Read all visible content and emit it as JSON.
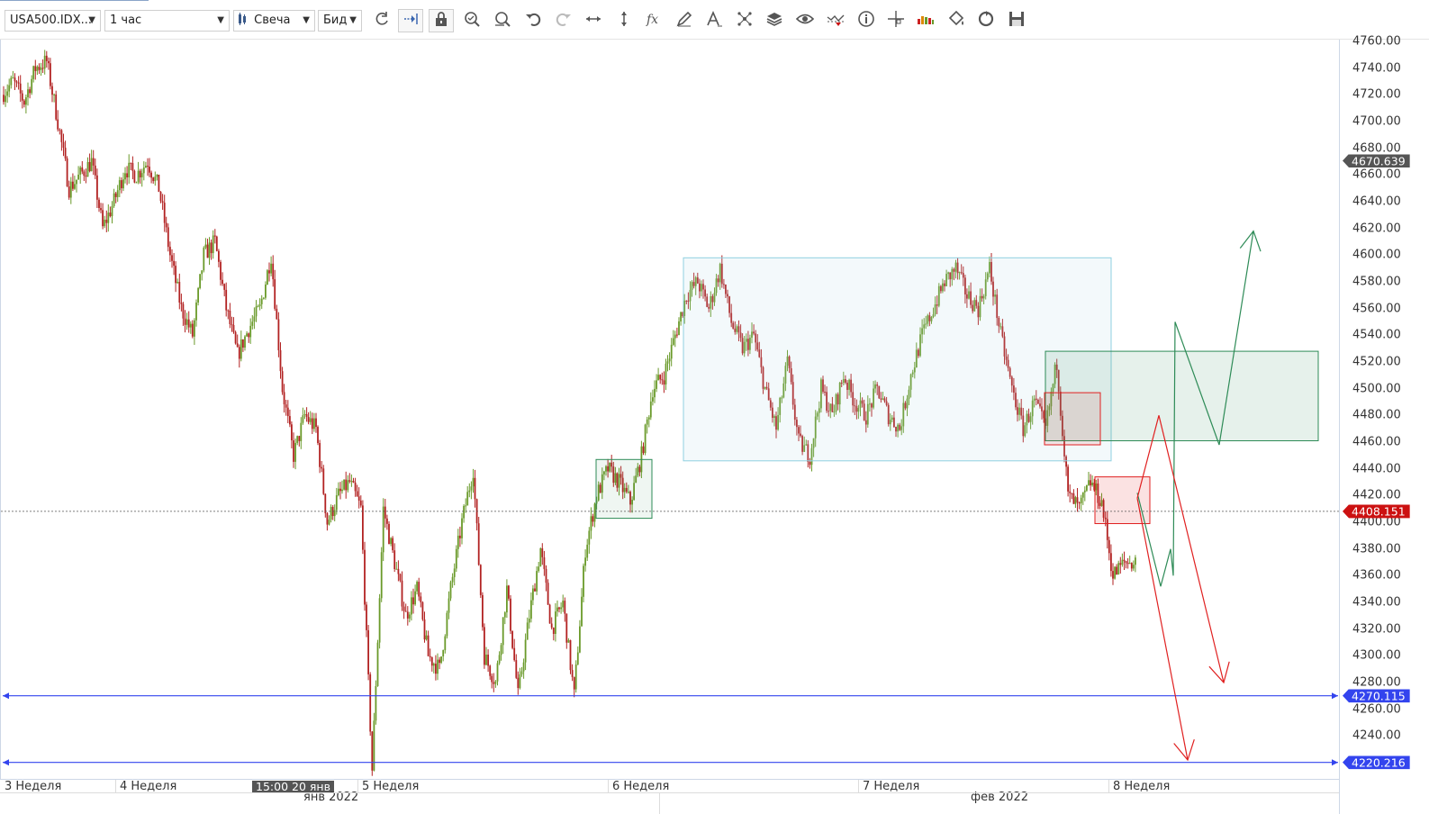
{
  "toolbar": {
    "symbol": "USA500.IDX...",
    "timeframe": "1 час",
    "chart_type": "Свеча",
    "price_side": "Бид",
    "icons": [
      "refresh-icon",
      "auto-scroll-icon",
      "lock-icon",
      "zoom-in-icon",
      "zoom-out-icon",
      "undo-icon",
      "redo-icon",
      "horizontal-stretch-icon",
      "vertical-stretch-icon",
      "indicator-fx-icon",
      "pencil-icon",
      "text-tool-icon",
      "network-icon",
      "layers-icon",
      "eye-icon",
      "signals-icon",
      "info-icon",
      "crosshair-icon",
      "volume-icon",
      "paint-bucket-icon",
      "sync-icon",
      "save-icon"
    ]
  },
  "price_axis": {
    "ticks": [
      "4760.00",
      "4740.00",
      "4720.00",
      "4700.00",
      "4680.00",
      "4660.00",
      "4640.00",
      "4620.00",
      "4600.00",
      "4580.00",
      "4560.00",
      "4540.00",
      "4520.00",
      "4500.00",
      "4480.00",
      "4460.00",
      "4440.00",
      "4420.00",
      "4400.00",
      "4380.00",
      "4360.00",
      "4340.00",
      "4320.00",
      "4300.00",
      "4280.00",
      "4260.00",
      "4240.00",
      "4220.00"
    ],
    "tags": [
      {
        "label": "4670.639",
        "price": 4670.639,
        "color": "#555555"
      },
      {
        "label": "4408.151",
        "price": 4408.151,
        "color": "#cc1111"
      },
      {
        "label": "4270.115",
        "price": 4270.115,
        "color": "#3344ee"
      },
      {
        "label": "4220.216",
        "price": 4220.216,
        "color": "#3344ee"
      }
    ]
  },
  "time_axis": {
    "weeks": [
      "3 Неделя",
      "4 Неделя",
      "5 Неделя",
      "6 Неделя",
      "7 Неделя",
      "8 Неделя"
    ],
    "months": [
      "янв 2022",
      "фев 2022"
    ],
    "cursor_label": "15:00 20 янв"
  },
  "chart_data": {
    "type": "candlestick",
    "symbol": "USA500.IDX",
    "timeframe": "1 час",
    "ylim": [
      4205,
      4765
    ],
    "current_price": 4408.151,
    "horizontal_lines": [
      4270.115,
      4220.216
    ],
    "colors": {
      "up": "#6a9a2a",
      "down": "#b22222",
      "hline": "#3344ee",
      "current": "#555555"
    },
    "path": [
      4720,
      4730,
      4715,
      4740,
      4745,
      4700,
      4650,
      4660,
      4670,
      4620,
      4640,
      4665,
      4660,
      4670,
      4650,
      4600,
      4560,
      4540,
      4600,
      4610,
      4560,
      4525,
      4545,
      4560,
      4600,
      4500,
      4450,
      4480,
      4470,
      4400,
      4420,
      4430,
      4410,
      4215,
      4410,
      4370,
      4330,
      4350,
      4300,
      4290,
      4350,
      4400,
      4440,
      4300,
      4280,
      4350,
      4270,
      4330,
      4380,
      4320,
      4340,
      4270,
      4380,
      4420,
      4440,
      4430,
      4415,
      4450,
      4500,
      4510,
      4540,
      4570,
      4580,
      4560,
      4590,
      4550,
      4530,
      4540,
      4500,
      4470,
      4520,
      4460,
      4450,
      4500,
      4480,
      4510,
      4490,
      4480,
      4500,
      4480,
      4470,
      4510,
      4540,
      4560,
      4580,
      4590,
      4570,
      4560,
      4590,
      4540,
      4500,
      4470,
      4490,
      4470,
      4520,
      4420,
      4410,
      4430,
      4415,
      4360,
      4370,
      4370
    ],
    "annotations": {
      "rectangles": [
        {
          "price_top": 4598,
          "price_bottom": 4446,
          "stroke": "#8fd0e0",
          "fill": "rgba(173,216,230,0.15)"
        },
        {
          "price_top": 4447,
          "price_bottom": 4403,
          "stroke": "#2e8b57",
          "fill": "rgba(46,139,87,0.08)"
        },
        {
          "price_top": 4528,
          "price_bottom": 4461,
          "stroke": "#2e8b57",
          "fill": "rgba(46,139,87,0.12)"
        },
        {
          "price_top": 4497,
          "price_bottom": 4458,
          "stroke": "#e02020",
          "fill": "rgba(220,20,20,0.10)"
        },
        {
          "price_top": 4434,
          "price_bottom": 4399,
          "stroke": "#e02020",
          "fill": "rgba(220,20,20,0.12)"
        }
      ],
      "arrows": [
        {
          "color": "#2e8b57",
          "prices": [
            4422,
            4352,
            4380,
            4360,
            4550,
            4458,
            4618
          ]
        },
        {
          "color": "#e02020",
          "prices": [
            4418,
            4480,
            4280
          ]
        },
        {
          "color": "#e02020",
          "prices": [
            4418,
            4222
          ]
        }
      ]
    }
  }
}
